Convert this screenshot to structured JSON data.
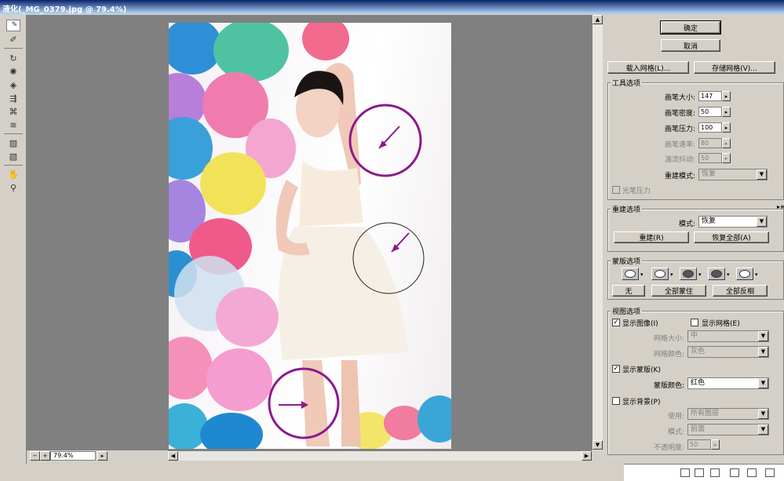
{
  "window": {
    "title": "液化(_MG_0379.jpg @ 79.4%)"
  },
  "status": {
    "zoom": "79.4%",
    "zoom_out": "−",
    "zoom_in": "+"
  },
  "buttons": {
    "ok": "确定",
    "cancel": "取消",
    "load_mesh": "载入网格(L)...",
    "save_mesh": "存储网格(V)..."
  },
  "tool_options": {
    "label": "工具选项",
    "brush_size": {
      "label": "画笔大小:",
      "value": "147"
    },
    "brush_density": {
      "label": "画笔密度:",
      "value": "50"
    },
    "brush_pressure": {
      "label": "画笔压力:",
      "value": "100"
    },
    "brush_rate": {
      "label": "画笔速率:",
      "value": "80"
    },
    "turbulent_jitter": {
      "label": "湍流抖动:",
      "value": "50"
    },
    "reconstruct_mode": {
      "label": "重建模式:",
      "value": "恢复"
    },
    "stylus_pressure": "光笔压力"
  },
  "reconstruct_options": {
    "label": "重建选项",
    "mode_label": "模式:",
    "mode_value": "恢复",
    "reconstruct": "重建(R)",
    "restore_all": "恢复全部(A)"
  },
  "mask_options": {
    "label": "蒙版选项",
    "none": "无",
    "mask_all": "全部蒙住",
    "invert_all": "全部反相"
  },
  "view_options": {
    "label": "视图选项",
    "show_image": "显示图像(I)",
    "show_mesh": "显示网格(E)",
    "mesh_size_label": "网格大小:",
    "mesh_size_value": "中",
    "mesh_color_label": "网格颜色:",
    "mesh_color_value": "灰色",
    "show_mask": "显示蒙版(K)",
    "mask_color_label": "蒙版颜色:",
    "mask_color_value": "红色",
    "show_backdrop": "显示背景(P)",
    "use_label": "使用:",
    "use_value": "所有图层",
    "mode_label": "模式:",
    "mode_value": "前面",
    "opacity_label": "不透明度:",
    "opacity_value": "50"
  },
  "colors": {
    "annotation": "#8b1a8b",
    "title_bar": "#0a246a"
  },
  "icons": [
    "forward-warp",
    "reconstruct",
    "twirl",
    "pucker",
    "bloat",
    "push-left",
    "mirror",
    "turbulence",
    "freeze-mask",
    "thaw-mask",
    "hand",
    "zoom"
  ]
}
